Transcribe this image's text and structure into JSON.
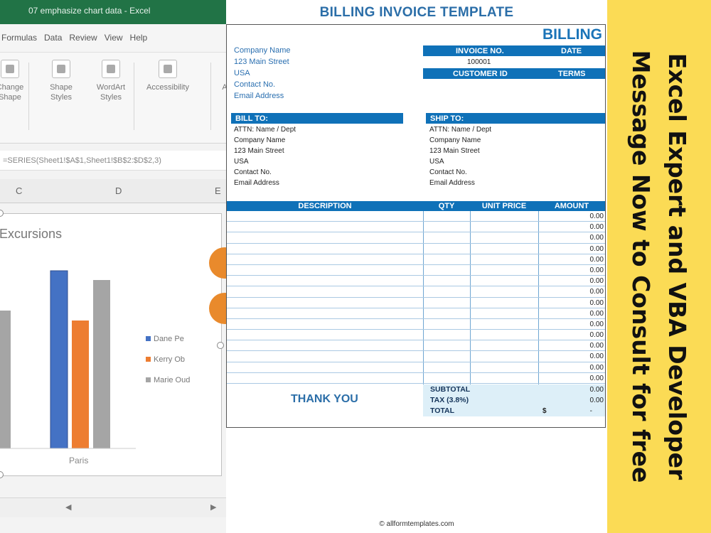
{
  "excel": {
    "window_title": "07 emphasize chart data - Excel",
    "menu": [
      "Formulas",
      "Data",
      "Review",
      "View",
      "Help"
    ],
    "ribbon_groups": [
      {
        "label": "Change\nShape",
        "icon": "shape-icon"
      },
      {
        "label": "Shape\nStyles",
        "icon": "shape-styles-icon"
      },
      {
        "label": "WordArt\nStyles",
        "icon": "wordart-icon"
      },
      {
        "label": "Accessibility",
        "icon": "accessibility-icon"
      },
      {
        "label": "Arrange",
        "icon": "arrange-icon"
      }
    ],
    "formula": "=SERIES(Sheet1!$A$1,Sheet1!$B$2:$D$2,3)",
    "column_headers": [
      "C",
      "D",
      "E"
    ],
    "chart": {
      "title": "Excursions",
      "legend": [
        "Dane Pe",
        "Kerry Ob",
        "Marie Oud"
      ],
      "category_label": "Paris"
    },
    "colors": {
      "ribbon_green": "#217346",
      "series_blue": "#4472c4",
      "series_orange": "#ed7d31",
      "series_gray": "#a5a5a5"
    }
  },
  "invoice": {
    "title": "BILLING INVOICE TEMPLATE",
    "heading": "BILLING",
    "company": [
      "Company Name",
      "123 Main Street",
      "USA",
      "Contact No.",
      "Email Address"
    ],
    "invoice_no_label": "INVOICE NO.",
    "date_label": "DATE",
    "invoice_no": "100001",
    "customer_id_label": "CUSTOMER ID",
    "terms_label": "TERMS",
    "bill_to": {
      "label": "BILL TO:",
      "lines": [
        "ATTN: Name / Dept",
        "Company Name",
        "123 Main Street",
        "USA",
        "Contact No.",
        "Email Address"
      ]
    },
    "ship_to": {
      "label": "SHIP TO:",
      "lines": [
        "ATTN: Name / Dept",
        "Company Name",
        "123 Main Street",
        "USA",
        "Contact No.",
        "Email Address"
      ]
    },
    "columns": {
      "description": "DESCRIPTION",
      "qty": "QTY",
      "unit_price": "UNIT PRICE",
      "amount": "AMOUNT"
    },
    "amounts": [
      "0.00",
      "0.00",
      "0.00",
      "0.00",
      "0.00",
      "0.00",
      "0.00",
      "0.00",
      "0.00",
      "0.00",
      "0.00",
      "0.00",
      "0.00",
      "0.00",
      "0.00",
      "0.00"
    ],
    "subtotal_label": "SUBTOTAL",
    "subtotal": "0.00",
    "tax_label": "TAX (3.8%)",
    "tax": "0.00",
    "total_label": "TOTAL",
    "total_currency": "$",
    "total": "-",
    "thank_you": "THANK YOU",
    "copyright": "© allformtemplates.com",
    "colors": {
      "header_blue": "#0f71b8",
      "title_blue": "#2b6ea8",
      "totals_bg": "#ddeff8"
    }
  },
  "banner": {
    "lines": [
      "Excel Expert and VBA Developer",
      "Message Now to Consult for free"
    ],
    "background": "#fbdb55"
  }
}
